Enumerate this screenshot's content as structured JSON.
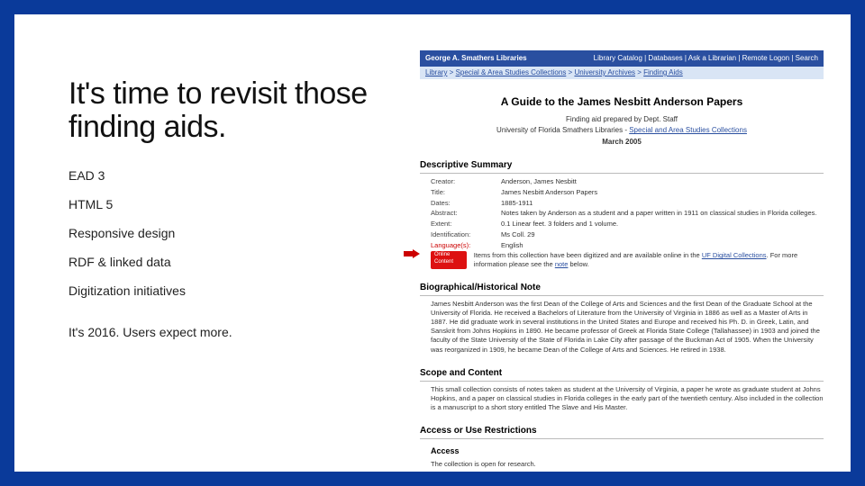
{
  "left": {
    "headline": "It's time to revisit those finding aids.",
    "bullets": [
      "EAD 3",
      "HTML 5",
      "Responsive design",
      "RDF & linked data",
      "Digitization initiatives"
    ],
    "closing": "It's 2016.  Users expect more."
  },
  "topbar": {
    "brand": "George A. Smathers Libraries",
    "links": "Library Catalog | Databases | Ask a Librarian | Remote Logon | Search"
  },
  "breadcrumb": {
    "a": "Library",
    "b": "Special & Area Studies Collections",
    "c": "University Archives",
    "d": "Finding Aids"
  },
  "guide": {
    "title": "A Guide to the James Nesbitt Anderson Papers",
    "prepared": "Finding aid prepared by Dept. Staff",
    "org1": "University of Florida Smathers Libraries - ",
    "orglink": "Special and Area Studies Collections",
    "date": "March 2005"
  },
  "ds": {
    "header": "Descriptive Summary",
    "creator": "Anderson, James Nesbitt",
    "title": "James Nesbitt Anderson Papers",
    "dates": "1885-1911",
    "abstract": "Notes taken by Anderson as a student and a paper written in 1911 on classical studies in Florida colleges.",
    "extent": "0.1 Linear feet. 3 folders and 1 volume.",
    "ident": "Ms Coll. 29",
    "lang": "English",
    "oclabel": "Online Content",
    "ocval1": "Items from this collection have been digitized and are available online in the ",
    "oclink": "UF Digital Collections",
    "ocval2": ". For more information please see the ",
    "ocnote": "note",
    "ocval3": " below."
  },
  "bio": {
    "header": "Biographical/Historical Note",
    "text": "James Nesbitt Anderson was the first Dean of the College of Arts and Sciences and the first Dean of the Graduate School at the University of Florida. He received a Bachelors of Literature from the University of Virginia in 1886 as well as a Master of Arts in 1887. He did graduate work in several institutions in the United States and Europe and received his Ph. D. in Greek, Latin, and Sanskrit from Johns Hopkins in 1890. He became professor of Greek at Florida State College (Tallahassee) in 1903 and joined the faculty of the State University of the State of Florida in Lake City after passage of the Buckman Act of 1905. When the University was reorganized in 1909, he became Dean of the College of Arts and Sciences. He retired in 1938."
  },
  "scope": {
    "header": "Scope and Content",
    "text": "This small collection consists of notes taken as student at the University of Virginia, a paper he wrote as graduate student at Johns Hopkins, and a paper on classical studies in Florida colleges in the early part of the twentieth century. Also included in the collection is a manuscript to a short story entitled The Slave and His Master."
  },
  "access": {
    "header": "Access or Use Restrictions",
    "sub": "Access",
    "text": "The collection is open for research."
  },
  "labels": {
    "creator": "Creator:",
    "title": "Title:",
    "dates": "Dates:",
    "abstract": "Abstract:",
    "extent": "Extent:",
    "ident": "Identification:",
    "lang": "Language(s):"
  }
}
